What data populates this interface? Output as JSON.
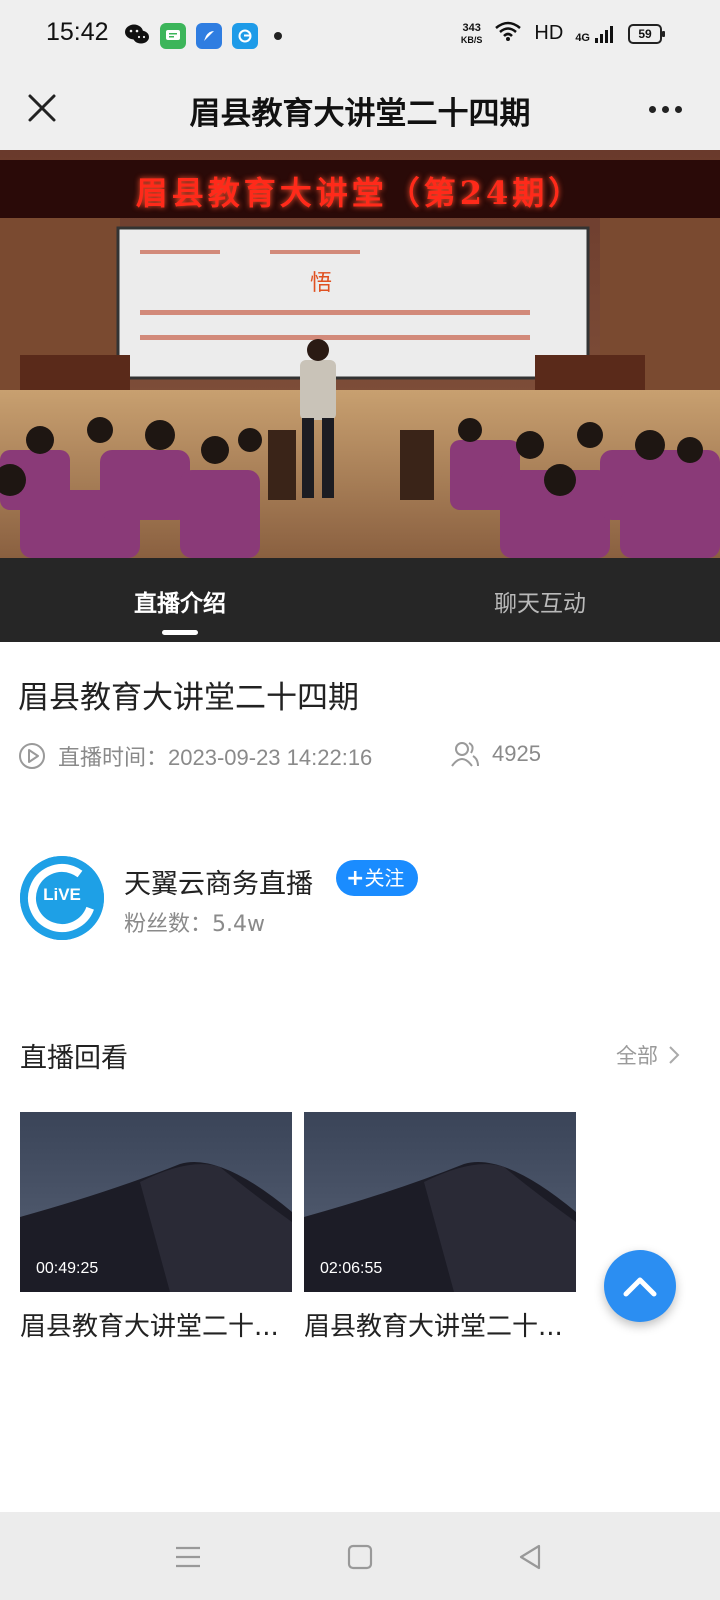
{
  "status_bar": {
    "time": "15:42",
    "net_speed_value": "343",
    "net_speed_unit": "KB/S",
    "hd_label": "HD",
    "network_label": "4G",
    "battery": "59"
  },
  "title_bar": {
    "title": "眉县教育大讲堂二十四期"
  },
  "video": {
    "banner_text": "眉县教育大讲堂（第24期）"
  },
  "tabs": [
    {
      "label": "直播介绍",
      "active": true
    },
    {
      "label": "聊天互动",
      "active": false
    }
  ],
  "live": {
    "title": "眉县教育大讲堂二十四期",
    "time_label": "直播时间：2023-09-23 14:22:16",
    "viewers": "4925"
  },
  "channel": {
    "avatar_text": "LiVE",
    "name": "天翼云商务直播",
    "follow_label": "关注",
    "fans_label": "粉丝数：5.4w"
  },
  "replay": {
    "heading": "直播回看",
    "view_all": "全部",
    "items": [
      {
        "duration": "00:49:25",
        "title": "眉县教育大讲堂二十..."
      },
      {
        "duration": "02:06:55",
        "title": "眉县教育大讲堂二十..."
      }
    ]
  },
  "colors": {
    "accent_blue": "#1a8cff",
    "tab_bar_bg": "#262626",
    "scroll_top_bg": "#2b8ef2"
  }
}
